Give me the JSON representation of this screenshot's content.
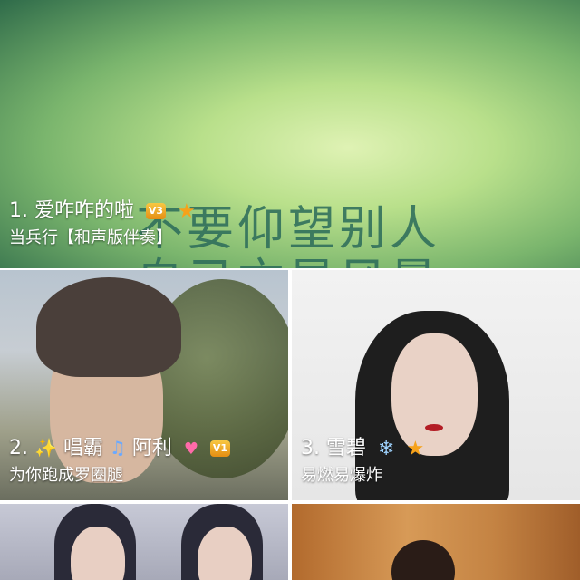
{
  "tiles": [
    {
      "rank": "1.",
      "name": "爱咋咋的啦",
      "badges": [
        "V3-badge-icon",
        "star-icon"
      ],
      "song": "当兵行【和声版伴奏】",
      "background_text": [
        "不要仰望别人",
        "自己亦是风景"
      ]
    },
    {
      "rank": "2.",
      "name": "唱霸",
      "name2": "阿利",
      "badges": [
        "sparkle-icon",
        "music-note-icon",
        "heart-icon",
        "V1-badge-icon"
      ],
      "song": "为你跑成罗圈腿"
    },
    {
      "rank": "3.",
      "name": "雪碧",
      "badges": [
        "snowflake-icon",
        "star-icon"
      ],
      "song": "易燃易爆炸"
    }
  ],
  "badge_labels": {
    "v3": "V3",
    "v1": "V1"
  },
  "colors": {
    "caption": "#ffffff",
    "star": "#f6a21a",
    "badge_gold": "#f0a724",
    "snow": "#9fd3ff",
    "heart": "#ff6aa9"
  }
}
